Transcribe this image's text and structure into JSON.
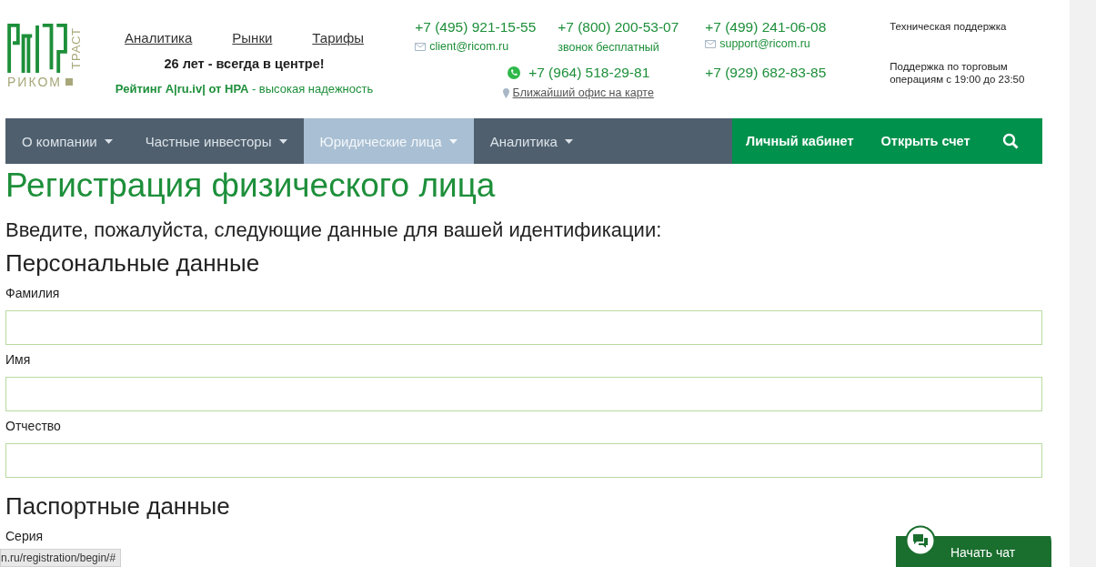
{
  "logo": {
    "name": "РИКОМ",
    "tagline": "ТРАСТ"
  },
  "top_links": [
    {
      "label": "Аналитика"
    },
    {
      "label": "Рынки"
    },
    {
      "label": "Тарифы"
    }
  ],
  "slogan": "26 лет - всегда в центре!",
  "rating": "**Рейтинг A|ru.iv| от НРА** - высокая надежность",
  "contacts": {
    "phone_1": "+7 (495) 921-15-55",
    "email_1": "client@ricom.ru",
    "phone_2": "+7 (800) 200-53-07",
    "phone_2_note": "звонок бесплатный",
    "phone_3": "+7 (499) 241-06-08",
    "email_2": "support@ricom.ru",
    "whatsapp": "+7 (964) 518-29-81",
    "office_link": "Ближайший офис на карте",
    "phone_4": "+7 (929) 682-83-85"
  },
  "support": {
    "title": "Техническая поддержка",
    "hours": "Поддержка по торговым операциям с 19:00 до 23:50"
  },
  "nav": [
    {
      "label": "О компании",
      "selected": false
    },
    {
      "label": "Частные инвесторы",
      "selected": false
    },
    {
      "label": "Юридические лица",
      "selected": true
    },
    {
      "label": "Аналитика",
      "selected": false
    }
  ],
  "nav_actions": [
    {
      "label": "Личный кабинет"
    },
    {
      "label": "Открыть счет"
    }
  ],
  "page_title": "Регистрация физического лица",
  "intro": "Введите, пожалуйста, следующие данные для вашей идентификации:",
  "sections": [
    {
      "title": "Персональные данные",
      "fields": [
        {
          "label": "Фамилия"
        },
        {
          "label": "Имя"
        },
        {
          "label": "Отчество"
        }
      ]
    },
    {
      "title": "Паспортные данные",
      "fields": [
        {
          "label": "Серия"
        }
      ]
    }
  ],
  "status_url": "n.ru/registration/begin/#",
  "chat_button": "Начать чат"
}
